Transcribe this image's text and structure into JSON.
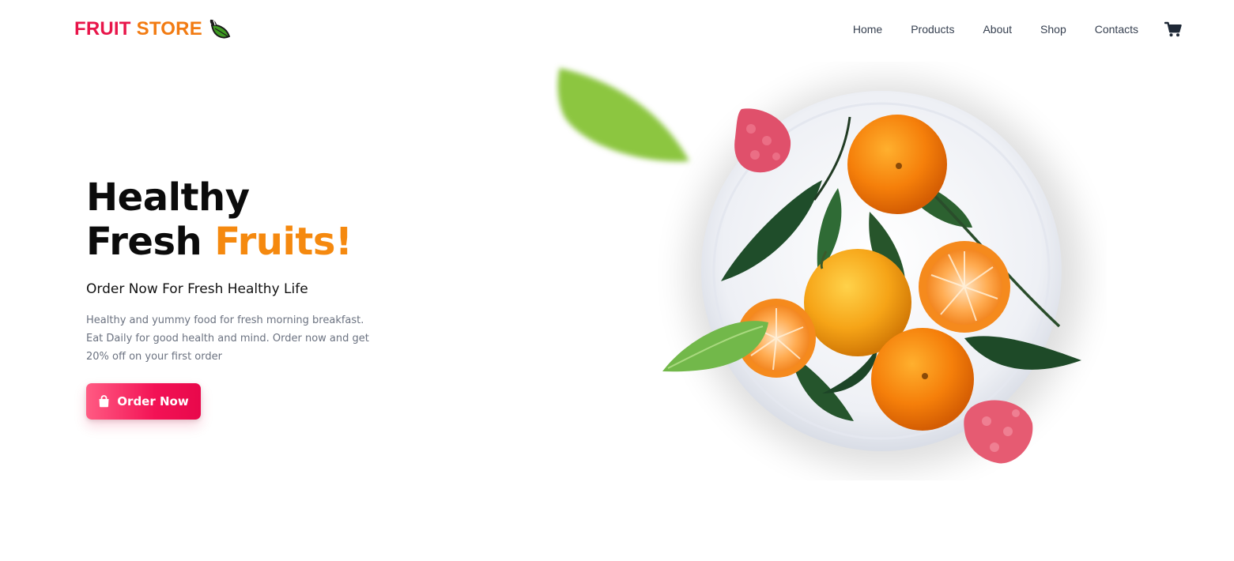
{
  "brand": {
    "word1": "FRUIT",
    "word2": "STORE",
    "logo_icon": "leaf-icon",
    "colors": {
      "word1": "#e8154a",
      "word2": "#f27b12"
    }
  },
  "nav": {
    "items": [
      {
        "label": "Home"
      },
      {
        "label": "Products"
      },
      {
        "label": "About"
      },
      {
        "label": "Shop"
      },
      {
        "label": "Contacts"
      }
    ],
    "cart_icon": "shopping-cart-icon"
  },
  "hero": {
    "title_line1": "Healthy",
    "title_line2_word": "Fresh",
    "title_line2_accent": "Fruits!",
    "subtitle": "Order Now For Fresh Healthy Life",
    "description_line1": "Healthy and yummy food for fresh morning breakfast.",
    "description_line2": "Eat Daily for good health and mind. Order now and get",
    "description_line3": "20% off on your first order",
    "cta_label": "Order Now",
    "cta_icon": "shopping-bag-icon",
    "accent_color": "#f5890f",
    "cta_color": "#f31255"
  }
}
